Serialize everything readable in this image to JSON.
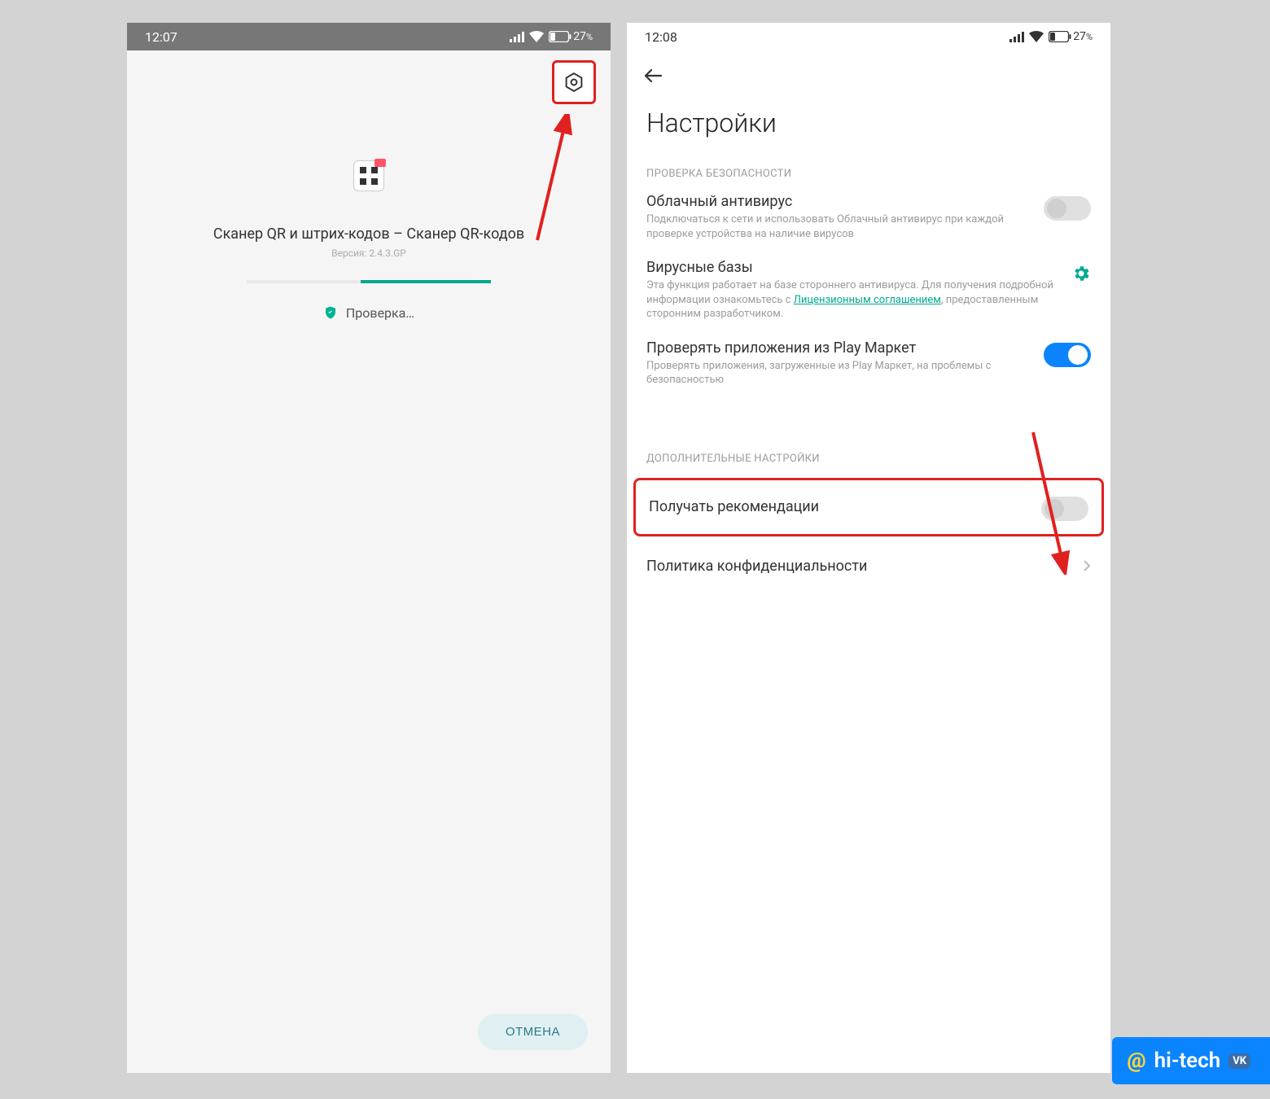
{
  "left": {
    "status": {
      "time": "12:07",
      "battery": "27",
      "pct": "%"
    },
    "app_name": "Сканер QR и штрих-кодов – Сканер QR-кодов",
    "app_version": "Версия: 2.4.3.GP",
    "checking": "Проверка…",
    "cancel": "ОТМЕНА"
  },
  "right": {
    "status": {
      "time": "12:08",
      "battery": "27",
      "pct": "%"
    },
    "title": "Настройки",
    "section1": "ПРОВЕРКА БЕЗОПАСНОСТИ",
    "cloud_av": {
      "title": "Облачный антивирус",
      "sub": "Подключаться к сети и использовать Облачный антивирус при каждой проверке устройства на наличие вирусов"
    },
    "virus_db": {
      "title": "Вирусные базы",
      "sub_pre": "Эта функция работает на базе стороннего антивируса. Для получения подробной информации ознакомьтесь с ",
      "link": "Лицензионным соглашением",
      "sub_post": ", предоставленным сторонним разработчиком."
    },
    "play": {
      "title": "Проверять приложения из Play Маркет",
      "sub": "Проверять приложения, загруженные из Play Маркет, на проблемы с безопасностью"
    },
    "section2": "ДОПОЛНИТЕЛЬНЫЕ НАСТРОЙКИ",
    "reco": {
      "title": "Получать рекомендации"
    },
    "privacy": {
      "title": "Политика конфиденциальности"
    }
  },
  "watermark": {
    "at": "@",
    "text": "hi-tech",
    "vk": "VK"
  }
}
